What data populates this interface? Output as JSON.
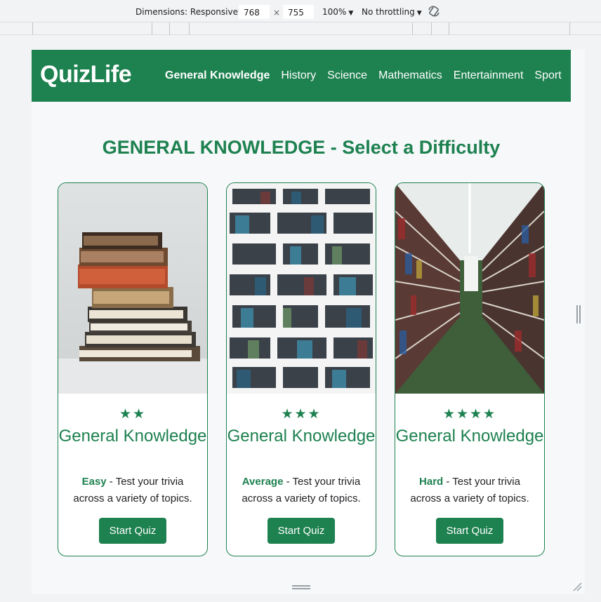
{
  "devtools": {
    "dimensions_label": "Dimensions: Responsive",
    "width_value": "768",
    "times": "×",
    "height_value": "755",
    "zoom": "100%",
    "throttling": "No throttling",
    "rotate_icon": "rotate-icon"
  },
  "site": {
    "brand": "QuizLife",
    "nav": [
      {
        "label": "General Knowledge",
        "active": true
      },
      {
        "label": "History"
      },
      {
        "label": "Science"
      },
      {
        "label": "Mathematics"
      },
      {
        "label": "Entertainment"
      },
      {
        "label": "Sport"
      }
    ],
    "heading": "GENERAL KNOWLEDGE - Select a Difficulty",
    "cards": [
      {
        "stars": "★★",
        "title": "General Knowledge",
        "level": "Easy",
        "desc": " - Test your trivia across a variety of topics.",
        "button": "Start Quiz",
        "image": "stacked-books-image"
      },
      {
        "stars": "★★★",
        "title": "General Knowledge",
        "level": "Average",
        "desc": " - Test your trivia across a variety of topics.",
        "button": "Start Quiz",
        "image": "bookshelf-image"
      },
      {
        "stars": "★★★★",
        "title": "General Knowledge",
        "level": "Hard",
        "desc": " - Test your trivia across a variety of topics.",
        "button": "Start Quiz",
        "image": "library-aisle-image"
      }
    ]
  },
  "colors": {
    "brand_green": "#1e8150",
    "background": "#f6f8fa"
  }
}
